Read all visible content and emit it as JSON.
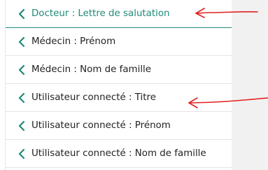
{
  "colors": {
    "accent": "#1f8a7a",
    "text": "#222222",
    "divider": "#e4e4e4",
    "annotation": "#e02020",
    "side_panel": "#f1f1f1"
  },
  "fields": [
    {
      "label": "Docteur : Lettre de salutation",
      "icon": "chevron-left-icon",
      "active": true
    },
    {
      "label": "Médecin : Prénom",
      "icon": "chevron-left-icon",
      "active": false
    },
    {
      "label": "Médecin : Nom de famille",
      "icon": "chevron-left-icon",
      "active": false
    },
    {
      "label": "Utilisateur connecté : Titre",
      "icon": "chevron-left-icon",
      "active": false
    },
    {
      "label": "Utilisateur connecté : Prénom",
      "icon": "chevron-left-icon",
      "active": false
    },
    {
      "label": "Utilisateur connecté : Nom de famille",
      "icon": "chevron-left-icon",
      "active": false
    }
  ],
  "annotations": [
    {
      "type": "arrow",
      "points_to": "fields.0"
    },
    {
      "type": "arrow",
      "points_to": "fields.3"
    }
  ]
}
